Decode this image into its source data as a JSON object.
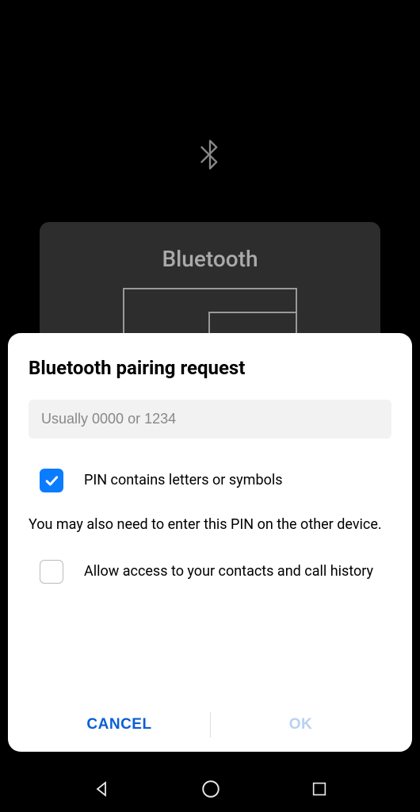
{
  "background": {
    "card_title": "Bluetooth"
  },
  "dialog": {
    "title": "Bluetooth pairing request",
    "pin_placeholder": "Usually 0000 or 1234",
    "pin_value": "",
    "letters_checkbox": {
      "checked": true,
      "label": "PIN contains letters or symbols"
    },
    "hint": "You may also need to enter this PIN on the other device.",
    "contacts_checkbox": {
      "checked": false,
      "label": "Allow access to your contacts and call history"
    },
    "cancel_label": "CANCEL",
    "ok_label": "OK"
  }
}
